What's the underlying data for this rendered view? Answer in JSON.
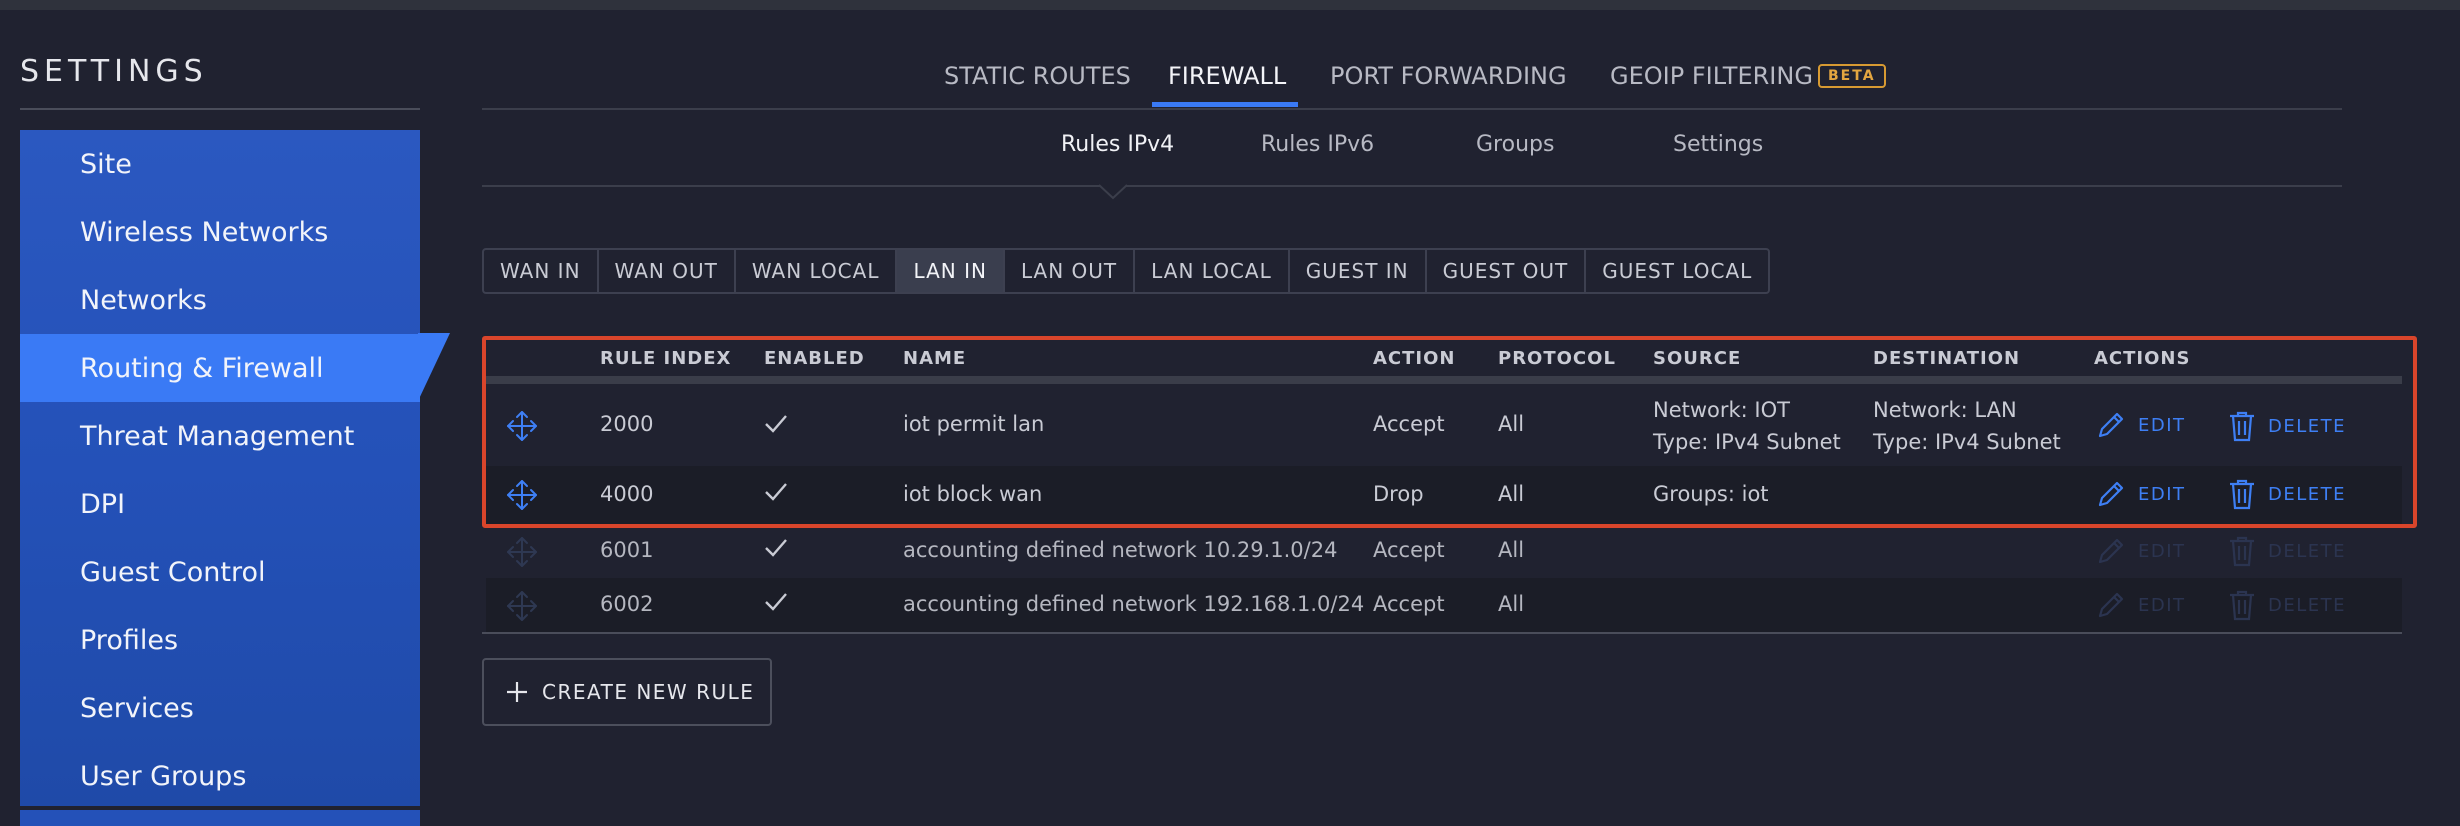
{
  "sidebar": {
    "title": "SETTINGS",
    "items": [
      {
        "label": "Site"
      },
      {
        "label": "Wireless Networks"
      },
      {
        "label": "Networks"
      },
      {
        "label": "Routing & Firewall"
      },
      {
        "label": "Threat Management"
      },
      {
        "label": "DPI"
      },
      {
        "label": "Guest Control"
      },
      {
        "label": "Profiles"
      },
      {
        "label": "Services"
      },
      {
        "label": "User Groups"
      }
    ],
    "active": "Routing & Firewall"
  },
  "tabs": {
    "items": [
      {
        "label": "STATIC ROUTES"
      },
      {
        "label": "FIREWALL"
      },
      {
        "label": "PORT FORWARDING"
      },
      {
        "label": "GEOIP FILTERING"
      }
    ],
    "active": "FIREWALL",
    "beta_badge": "BETA"
  },
  "subtabs": {
    "items": [
      {
        "label": "Rules IPv4"
      },
      {
        "label": "Rules IPv6"
      },
      {
        "label": "Groups"
      },
      {
        "label": "Settings"
      }
    ],
    "active": "Rules IPv4"
  },
  "chains": {
    "items": [
      "WAN IN",
      "WAN OUT",
      "WAN LOCAL",
      "LAN IN",
      "LAN OUT",
      "LAN LOCAL",
      "GUEST IN",
      "GUEST OUT",
      "GUEST LOCAL"
    ],
    "active": "LAN IN"
  },
  "table": {
    "headers": {
      "rule_index": "RULE INDEX",
      "enabled": "ENABLED",
      "name": "NAME",
      "action": "ACTION",
      "protocol": "PROTOCOL",
      "source": "SOURCE",
      "destination": "DESTINATION",
      "actions": "ACTIONS"
    },
    "edit_label": "EDIT",
    "delete_label": "DELETE",
    "rows": [
      {
        "index": "2000",
        "name": "iot permit lan",
        "action": "Accept",
        "protocol": "All",
        "source_1": "Network: IOT",
        "source_2": "Type: IPv4 Subnet",
        "dest_1": "Network: LAN",
        "dest_2": "Type: IPv4 Subnet"
      },
      {
        "index": "4000",
        "name": "iot block wan",
        "action": "Drop",
        "protocol": "All",
        "source_1": "Groups:  iot",
        "source_2": "",
        "dest_1": "",
        "dest_2": ""
      },
      {
        "index": "6001",
        "name": "accounting defined network 10.29.1.0/24",
        "action": "Accept",
        "protocol": "All",
        "source_1": "",
        "source_2": "",
        "dest_1": "",
        "dest_2": ""
      },
      {
        "index": "6002",
        "name": "accounting defined network 192.168.1.0/24",
        "action": "Accept",
        "protocol": "All",
        "source_1": "",
        "source_2": "",
        "dest_1": "",
        "dest_2": ""
      }
    ]
  },
  "create_button": {
    "label": "CREATE NEW RULE"
  },
  "colors": {
    "accent": "#3a7af5",
    "highlight": "#d9452b",
    "beta": "#e3a640"
  }
}
